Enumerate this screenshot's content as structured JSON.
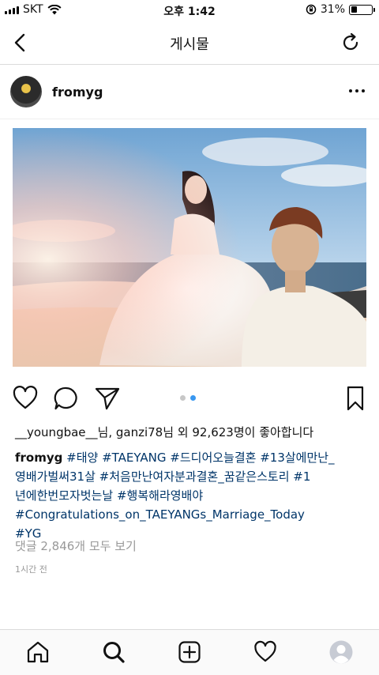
{
  "status_bar": {
    "carrier": "SKT",
    "time": "오후 1:42",
    "battery_percent": "31%",
    "battery_level": 0.31
  },
  "nav": {
    "title": "게시물",
    "back_icon": "chevron-left-icon",
    "refresh_icon": "refresh-icon"
  },
  "post": {
    "username": "fromyg",
    "carousel": {
      "count": 2,
      "active_index": 1
    },
    "likes": {
      "text": "__youngbae__님, ganzi78님 외 92,623명이 좋아합니다"
    },
    "caption": {
      "username": "fromyg",
      "line1_tags": "#태양 #TAEYANG #드디어오늘결혼 #13살에만난_",
      "line2": "영배가벌써31살 #처음만난여자분과결혼_꿈같은스토리 #1",
      "line3": "년에한번모자벗는날 #행복해라영배야",
      "line4": "#Congratulations_on_TAEYANGs_Marriage_Today",
      "line5": "#YG"
    },
    "comments_link": "댓글 2,846개 모두 보기",
    "timestamp": "1시간 전"
  },
  "tabbar": {
    "items": [
      "home-icon",
      "search-icon",
      "add-post-icon",
      "activity-heart-icon",
      "profile-icon"
    ]
  },
  "colors": {
    "link": "#003569",
    "muted": "#999999",
    "active_dot": "#3897f0",
    "divider": "#dbdbdb"
  }
}
